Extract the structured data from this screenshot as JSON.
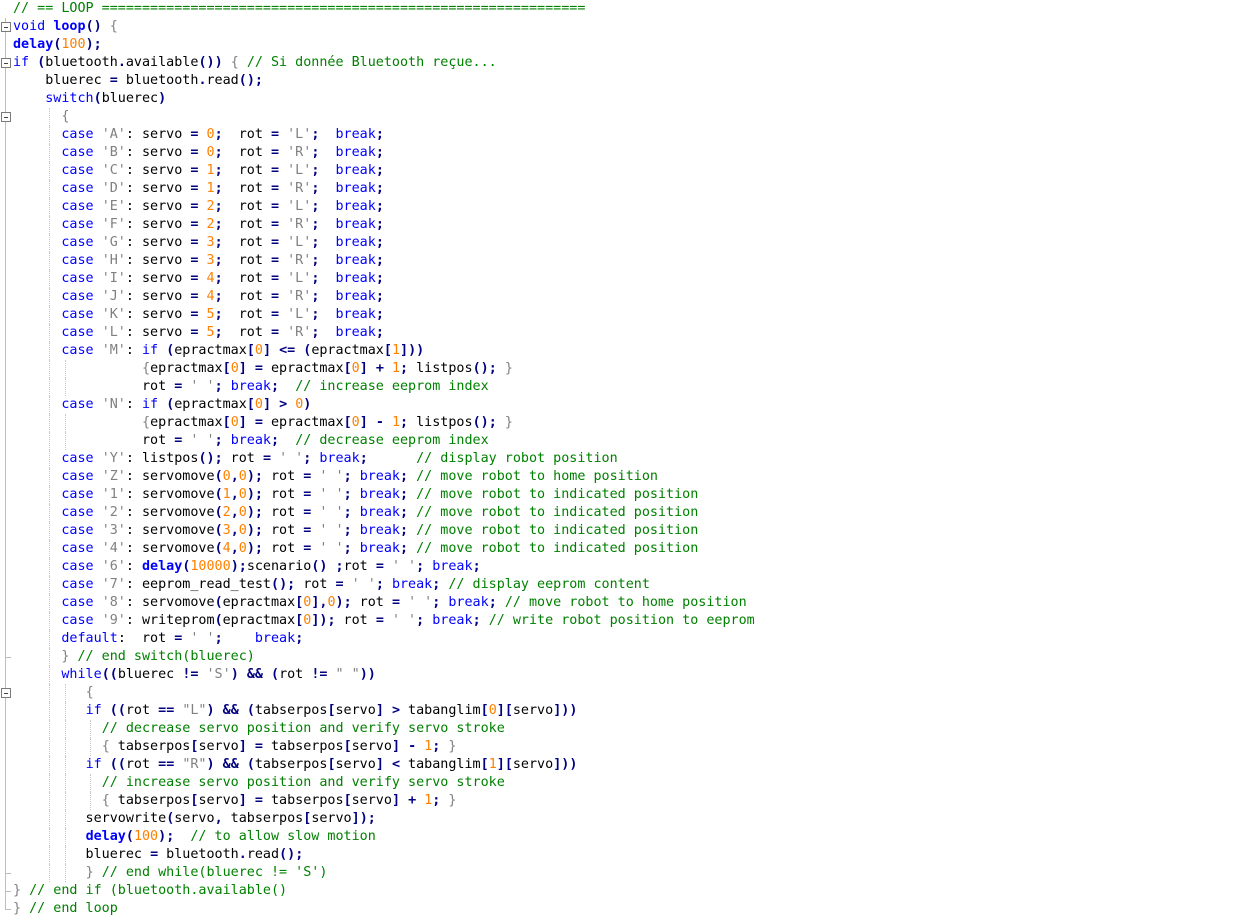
{
  "editor": {
    "language": "Arduino C++",
    "colors": {
      "background": "#ffffff",
      "keyword": "#0000ff",
      "function": "#000080",
      "number": "#ff8000",
      "string": "#808080",
      "comment": "#008000",
      "text": "#000000"
    },
    "lines": [
      "// == LOOP ============================================================",
      "void loop() {",
      "delay(100);",
      "if (bluetooth.available()) { // Si donnée Bluetooth reçue...",
      "    bluerec = bluetooth.read();",
      "    switch(bluerec)",
      "      {",
      "      case 'A': servo = 0;  rot = 'L';  break;",
      "      case 'B': servo = 0;  rot = 'R';  break;",
      "      case 'C': servo = 1;  rot = 'L';  break;",
      "      case 'D': servo = 1;  rot = 'R';  break;",
      "      case 'E': servo = 2;  rot = 'L';  break;",
      "      case 'F': servo = 2;  rot = 'R';  break;",
      "      case 'G': servo = 3;  rot = 'L';  break;",
      "      case 'H': servo = 3;  rot = 'R';  break;",
      "      case 'I': servo = 4;  rot = 'L';  break;",
      "      case 'J': servo = 4;  rot = 'R';  break;",
      "      case 'K': servo = 5;  rot = 'L';  break;",
      "      case 'L': servo = 5;  rot = 'R';  break;",
      "      case 'M': if (epractmax[0] <= (epractmax[1]))",
      "                {epractmax[0] = epractmax[0] + 1; listpos(); }",
      "                rot = ' '; break;  // increase eeprom index",
      "      case 'N': if (epractmax[0] > 0)",
      "                {epractmax[0] = epractmax[0] - 1; listpos(); }",
      "                rot = ' '; break;  // decrease eeprom index",
      "      case 'Y': listpos(); rot = ' '; break;      // display robot position",
      "      case 'Z': servomove(0,0); rot = ' '; break; // move robot to home position",
      "      case '1': servomove(1,0); rot = ' '; break; // move robot to indicated position",
      "      case '2': servomove(2,0); rot = ' '; break; // move robot to indicated position",
      "      case '3': servomove(3,0); rot = ' '; break; // move robot to indicated position",
      "      case '4': servomove(4,0); rot = ' '; break; // move robot to indicated position",
      "      case '6': delay(10000);scenario() ;rot = ' '; break;",
      "      case '7': eeprom_read_test(); rot = ' '; break; // display eeprom content",
      "      case '8': servomove(epractmax[0],0); rot = ' '; break; // move robot to home position",
      "      case '9': writeprom(epractmax[0]); rot = ' '; break; // write robot position to eeprom",
      "      default:  rot = ' ';    break;",
      "      } // end switch(bluerec)",
      "      while((bluerec != 'S') && (rot != \" \"))",
      "         {",
      "         if ((rot == \"L\") && (tabserpos[servo] > tabanglim[0][servo]))",
      "           // decrease servo position and verify servo stroke",
      "           { tabserpos[servo] = tabserpos[servo] - 1; }",
      "         if ((rot == \"R\") && (tabserpos[servo] < tabanglim[1][servo]))",
      "           // increase servo position and verify servo stroke",
      "           { tabserpos[servo] = tabserpos[servo] + 1; }",
      "         servowrite(servo, tabserpos[servo]);",
      "         delay(100);  // to allow slow motion",
      "         bluerec = bluetooth.read();",
      "         } // end while(bluerec != 'S')",
      "} // end if (bluetooth.available()",
      "} // end loop"
    ]
  }
}
